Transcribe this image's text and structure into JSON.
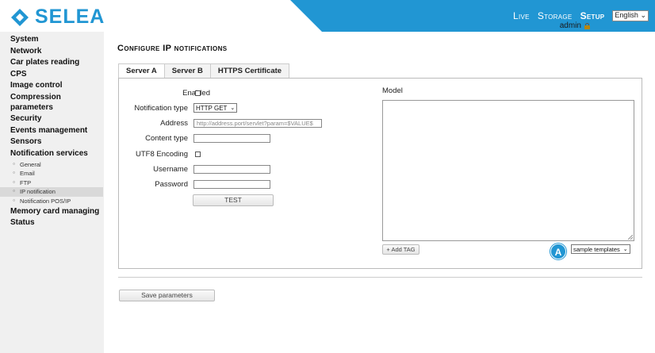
{
  "header": {
    "logo_text": "SELEA",
    "nav": [
      "Live",
      "Storage",
      "Setup"
    ],
    "active_nav": "Setup",
    "language": "English",
    "user": "admin"
  },
  "sidebar": {
    "items": [
      {
        "label": "System"
      },
      {
        "label": "Network"
      },
      {
        "label": "Car plates reading"
      },
      {
        "label": "CPS"
      },
      {
        "label": "Image control"
      },
      {
        "label": "Compression parameters"
      },
      {
        "label": "Security"
      },
      {
        "label": "Events management"
      },
      {
        "label": "Sensors"
      },
      {
        "label": "Notification services"
      }
    ],
    "sub_items": [
      {
        "label": "General"
      },
      {
        "label": "Email"
      },
      {
        "label": "FTP"
      },
      {
        "label": "IP notification",
        "active": true
      },
      {
        "label": "Notification POS/IP"
      }
    ],
    "after_items": [
      {
        "label": "Memory card managing"
      },
      {
        "label": "Status"
      }
    ]
  },
  "page": {
    "title": "Configure IP notifications",
    "tabs": [
      "Server A",
      "Server B",
      "HTTPS Certificate"
    ],
    "active_tab": "Server A"
  },
  "form": {
    "enabled_label": "Enabled",
    "notification_type_label": "Notification type",
    "notification_type_value": "HTTP GET",
    "address_label": "Address",
    "address_placeholder": "http://address.port/servlet?param=$VALUE$",
    "content_type_label": "Content type",
    "utf8_label": "UTF8 Encoding",
    "username_label": "Username",
    "password_label": "Password",
    "test_button": "TEST",
    "model_label": "Model",
    "add_tag_button": "+ Add TAG",
    "templates_select": "sample templates",
    "marker": "A"
  },
  "footer": {
    "save_button": "Save parameters"
  },
  "colors": {
    "accent": "#2196d3",
    "sidebar_bg": "#f0f0f0"
  }
}
